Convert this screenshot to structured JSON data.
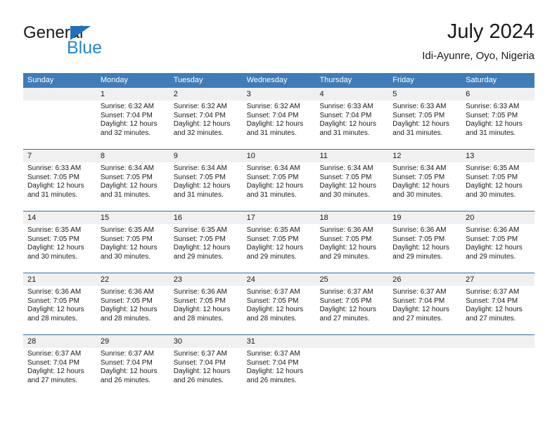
{
  "brand": {
    "name_top": "General",
    "name_bottom": "Blue",
    "triangle_color": "#1f72bd",
    "bottom_color": "#2585d3"
  },
  "header": {
    "title": "July 2024",
    "subtitle": "Idi-Ayunre, Oyo, Nigeria"
  },
  "theme": {
    "header_blue": "#3f7cb8",
    "rule_blue": "#2f6fae",
    "daynum_band": "#f0f0f0",
    "text": "#1a1a1a"
  },
  "weekdays": [
    "Sunday",
    "Monday",
    "Tuesday",
    "Wednesday",
    "Thursday",
    "Friday",
    "Saturday"
  ],
  "weeks": [
    {
      "days": [
        {
          "num": "",
          "lines": []
        },
        {
          "num": "1",
          "lines": [
            "Sunrise: 6:32 AM",
            "Sunset: 7:04 PM",
            "Daylight: 12 hours",
            "and 32 minutes."
          ]
        },
        {
          "num": "2",
          "lines": [
            "Sunrise: 6:32 AM",
            "Sunset: 7:04 PM",
            "Daylight: 12 hours",
            "and 32 minutes."
          ]
        },
        {
          "num": "3",
          "lines": [
            "Sunrise: 6:32 AM",
            "Sunset: 7:04 PM",
            "Daylight: 12 hours",
            "and 31 minutes."
          ]
        },
        {
          "num": "4",
          "lines": [
            "Sunrise: 6:33 AM",
            "Sunset: 7:04 PM",
            "Daylight: 12 hours",
            "and 31 minutes."
          ]
        },
        {
          "num": "5",
          "lines": [
            "Sunrise: 6:33 AM",
            "Sunset: 7:05 PM",
            "Daylight: 12 hours",
            "and 31 minutes."
          ]
        },
        {
          "num": "6",
          "lines": [
            "Sunrise: 6:33 AM",
            "Sunset: 7:05 PM",
            "Daylight: 12 hours",
            "and 31 minutes."
          ]
        }
      ]
    },
    {
      "days": [
        {
          "num": "7",
          "lines": [
            "Sunrise: 6:33 AM",
            "Sunset: 7:05 PM",
            "Daylight: 12 hours",
            "and 31 minutes."
          ]
        },
        {
          "num": "8",
          "lines": [
            "Sunrise: 6:34 AM",
            "Sunset: 7:05 PM",
            "Daylight: 12 hours",
            "and 31 minutes."
          ]
        },
        {
          "num": "9",
          "lines": [
            "Sunrise: 6:34 AM",
            "Sunset: 7:05 PM",
            "Daylight: 12 hours",
            "and 31 minutes."
          ]
        },
        {
          "num": "10",
          "lines": [
            "Sunrise: 6:34 AM",
            "Sunset: 7:05 PM",
            "Daylight: 12 hours",
            "and 31 minutes."
          ]
        },
        {
          "num": "11",
          "lines": [
            "Sunrise: 6:34 AM",
            "Sunset: 7:05 PM",
            "Daylight: 12 hours",
            "and 30 minutes."
          ]
        },
        {
          "num": "12",
          "lines": [
            "Sunrise: 6:34 AM",
            "Sunset: 7:05 PM",
            "Daylight: 12 hours",
            "and 30 minutes."
          ]
        },
        {
          "num": "13",
          "lines": [
            "Sunrise: 6:35 AM",
            "Sunset: 7:05 PM",
            "Daylight: 12 hours",
            "and 30 minutes."
          ]
        }
      ]
    },
    {
      "days": [
        {
          "num": "14",
          "lines": [
            "Sunrise: 6:35 AM",
            "Sunset: 7:05 PM",
            "Daylight: 12 hours",
            "and 30 minutes."
          ]
        },
        {
          "num": "15",
          "lines": [
            "Sunrise: 6:35 AM",
            "Sunset: 7:05 PM",
            "Daylight: 12 hours",
            "and 30 minutes."
          ]
        },
        {
          "num": "16",
          "lines": [
            "Sunrise: 6:35 AM",
            "Sunset: 7:05 PM",
            "Daylight: 12 hours",
            "and 29 minutes."
          ]
        },
        {
          "num": "17",
          "lines": [
            "Sunrise: 6:35 AM",
            "Sunset: 7:05 PM",
            "Daylight: 12 hours",
            "and 29 minutes."
          ]
        },
        {
          "num": "18",
          "lines": [
            "Sunrise: 6:36 AM",
            "Sunset: 7:05 PM",
            "Daylight: 12 hours",
            "and 29 minutes."
          ]
        },
        {
          "num": "19",
          "lines": [
            "Sunrise: 6:36 AM",
            "Sunset: 7:05 PM",
            "Daylight: 12 hours",
            "and 29 minutes."
          ]
        },
        {
          "num": "20",
          "lines": [
            "Sunrise: 6:36 AM",
            "Sunset: 7:05 PM",
            "Daylight: 12 hours",
            "and 29 minutes."
          ]
        }
      ]
    },
    {
      "days": [
        {
          "num": "21",
          "lines": [
            "Sunrise: 6:36 AM",
            "Sunset: 7:05 PM",
            "Daylight: 12 hours",
            "and 28 minutes."
          ]
        },
        {
          "num": "22",
          "lines": [
            "Sunrise: 6:36 AM",
            "Sunset: 7:05 PM",
            "Daylight: 12 hours",
            "and 28 minutes."
          ]
        },
        {
          "num": "23",
          "lines": [
            "Sunrise: 6:36 AM",
            "Sunset: 7:05 PM",
            "Daylight: 12 hours",
            "and 28 minutes."
          ]
        },
        {
          "num": "24",
          "lines": [
            "Sunrise: 6:37 AM",
            "Sunset: 7:05 PM",
            "Daylight: 12 hours",
            "and 28 minutes."
          ]
        },
        {
          "num": "25",
          "lines": [
            "Sunrise: 6:37 AM",
            "Sunset: 7:05 PM",
            "Daylight: 12 hours",
            "and 27 minutes."
          ]
        },
        {
          "num": "26",
          "lines": [
            "Sunrise: 6:37 AM",
            "Sunset: 7:04 PM",
            "Daylight: 12 hours",
            "and 27 minutes."
          ]
        },
        {
          "num": "27",
          "lines": [
            "Sunrise: 6:37 AM",
            "Sunset: 7:04 PM",
            "Daylight: 12 hours",
            "and 27 minutes."
          ]
        }
      ]
    },
    {
      "days": [
        {
          "num": "28",
          "lines": [
            "Sunrise: 6:37 AM",
            "Sunset: 7:04 PM",
            "Daylight: 12 hours",
            "and 27 minutes."
          ]
        },
        {
          "num": "29",
          "lines": [
            "Sunrise: 6:37 AM",
            "Sunset: 7:04 PM",
            "Daylight: 12 hours",
            "and 26 minutes."
          ]
        },
        {
          "num": "30",
          "lines": [
            "Sunrise: 6:37 AM",
            "Sunset: 7:04 PM",
            "Daylight: 12 hours",
            "and 26 minutes."
          ]
        },
        {
          "num": "31",
          "lines": [
            "Sunrise: 6:37 AM",
            "Sunset: 7:04 PM",
            "Daylight: 12 hours",
            "and 26 minutes."
          ]
        },
        {
          "num": "",
          "lines": []
        },
        {
          "num": "",
          "lines": []
        },
        {
          "num": "",
          "lines": []
        }
      ]
    }
  ]
}
